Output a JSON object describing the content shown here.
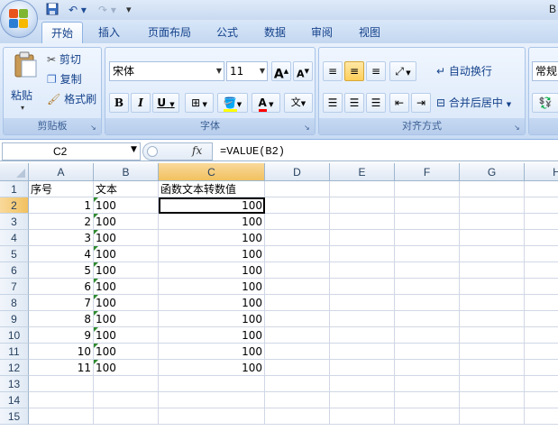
{
  "qat": {
    "undo_icon": "undo-icon",
    "redo_icon": "redo-icon",
    "save_icon": "save-icon",
    "customize": "▾"
  },
  "title_right": "B",
  "tabs": [
    {
      "label": "开始",
      "active": true
    },
    {
      "label": "插入"
    },
    {
      "label": "页面布局"
    },
    {
      "label": "公式"
    },
    {
      "label": "数据"
    },
    {
      "label": "审阅"
    },
    {
      "label": "视图"
    }
  ],
  "clipboard": {
    "paste": "粘贴",
    "cut": "剪切",
    "copy": "复制",
    "format_painter": "格式刷",
    "label": "剪贴板"
  },
  "font": {
    "name": "宋体",
    "size": "11",
    "bold": "B",
    "italic": "I",
    "underline": "U",
    "grow": "A",
    "shrink": "A",
    "font_color": "A",
    "phonetic": "文",
    "label": "字体"
  },
  "alignment": {
    "wrap": "自动换行",
    "merge": "合并后居中",
    "label": "对齐方式"
  },
  "number": {
    "format": "常规"
  },
  "formula_bar": {
    "name_box": "C2",
    "fx": "fx",
    "formula": "=VALUE(B2)"
  },
  "columns": [
    "A",
    "B",
    "C",
    "D",
    "E",
    "F",
    "G",
    "H"
  ],
  "rows": [
    "1",
    "2",
    "3",
    "4",
    "5",
    "6",
    "7",
    "8",
    "9",
    "10",
    "11",
    "12",
    "13",
    "14",
    "15"
  ],
  "cells": {
    "header": [
      "序号",
      "文本",
      "函数文本转数值"
    ],
    "data": [
      [
        "1",
        "100",
        "100"
      ],
      [
        "2",
        "100",
        "100"
      ],
      [
        "3",
        "100",
        "100"
      ],
      [
        "4",
        "100",
        "100"
      ],
      [
        "5",
        "100",
        "100"
      ],
      [
        "6",
        "100",
        "100"
      ],
      [
        "7",
        "100",
        "100"
      ],
      [
        "8",
        "100",
        "100"
      ],
      [
        "9",
        "100",
        "100"
      ],
      [
        "10",
        "100",
        "100"
      ],
      [
        "11",
        "100",
        "100"
      ]
    ]
  },
  "colors": {
    "accent": "#15428b",
    "selection": "#f1c15f",
    "text_number_marker": "#2e8b2e"
  }
}
